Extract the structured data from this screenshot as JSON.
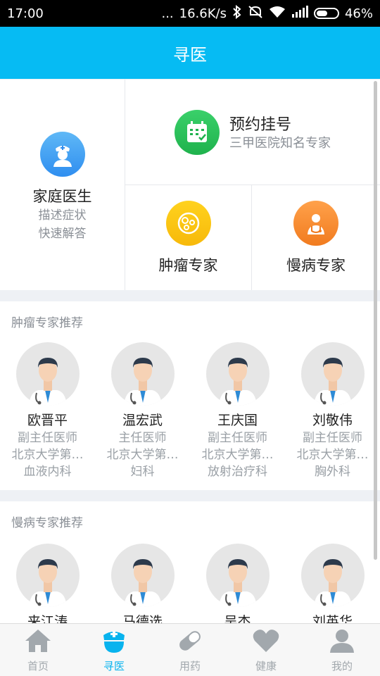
{
  "status_bar": {
    "time": "17:00",
    "dots": "...",
    "speed": "16.6K/s",
    "battery": "46%"
  },
  "header": {
    "title": "寻医"
  },
  "services": {
    "family": {
      "title": "家庭医生",
      "sub1": "描述症状",
      "sub2": "快速解答",
      "icon": "nurse-icon"
    },
    "appointment": {
      "title": "预约挂号",
      "sub": "三甲医院知名专家",
      "icon": "calendar-icon"
    },
    "tumor": {
      "title": "肿瘤专家",
      "icon": "cells-icon"
    },
    "chronic": {
      "title": "慢病专家",
      "icon": "doctor-icon"
    }
  },
  "tumor_section": {
    "title": "肿瘤专家推荐",
    "doctors": [
      {
        "name": "欧晋平",
        "title": "副主任医师",
        "hospital": "北京大学第…",
        "dept": "血液内科"
      },
      {
        "name": "温宏武",
        "title": "主任医师",
        "hospital": "北京大学第…",
        "dept": "妇科"
      },
      {
        "name": "王庆国",
        "title": "副主任医师",
        "hospital": "北京大学第…",
        "dept": "放射治疗科"
      },
      {
        "name": "刘敬伟",
        "title": "副主任医师",
        "hospital": "北京大学第…",
        "dept": "胸外科"
      }
    ]
  },
  "chronic_section": {
    "title": "慢病专家推荐",
    "doctors": [
      {
        "name": "来江涛"
      },
      {
        "name": "马德选"
      },
      {
        "name": "吴杰"
      },
      {
        "name": "刘英华"
      }
    ]
  },
  "tabbar": {
    "tabs": [
      {
        "label": "首页",
        "icon": "home-icon"
      },
      {
        "label": "寻医",
        "icon": "nurse-cap-icon",
        "active": true
      },
      {
        "label": "用药",
        "icon": "pill-icon"
      },
      {
        "label": "健康",
        "icon": "heart-icon"
      },
      {
        "label": "我的",
        "icon": "user-icon"
      }
    ]
  },
  "colors": {
    "primary": "#06bbf3",
    "active_tab": "#08b3ee",
    "green": "#1fb24d",
    "yellow": "#f7b90a",
    "orange": "#f17b1f"
  }
}
